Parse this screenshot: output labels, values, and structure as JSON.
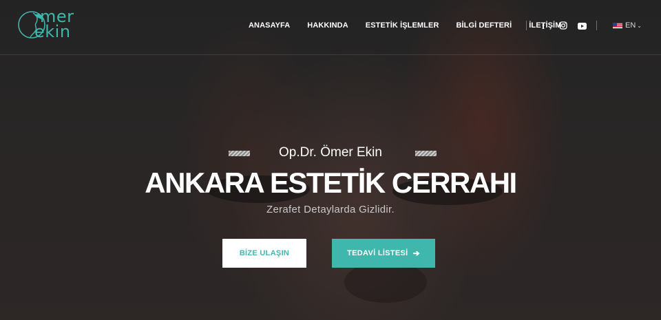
{
  "logo": {
    "line1": "mer",
    "line2": "ekin"
  },
  "nav": [
    {
      "label": "ANASAYFA"
    },
    {
      "label": "HAKKINDA"
    },
    {
      "label": "ESTETİK İŞLEMLER"
    },
    {
      "label": "BİLGİ DEFTERİ"
    },
    {
      "label": "İLETİŞİM"
    }
  ],
  "social": {
    "facebook": "f",
    "instagram": "instagram-icon",
    "youtube": "youtube-icon"
  },
  "language": {
    "label": "EN"
  },
  "hero": {
    "subtitle": "Op.Dr. Ömer Ekin",
    "title": "ANKARA ESTETİK CERRAHI",
    "tagline": "Zerafet Detaylarda Gizlidir.",
    "cta_primary": "BİZE ULAŞIN",
    "cta_secondary": "TEDAVİ LİSTESİ",
    "cta_secondary_arrow": "➔"
  },
  "colors": {
    "accent": "#3fb7ac",
    "text": "#ffffff"
  }
}
